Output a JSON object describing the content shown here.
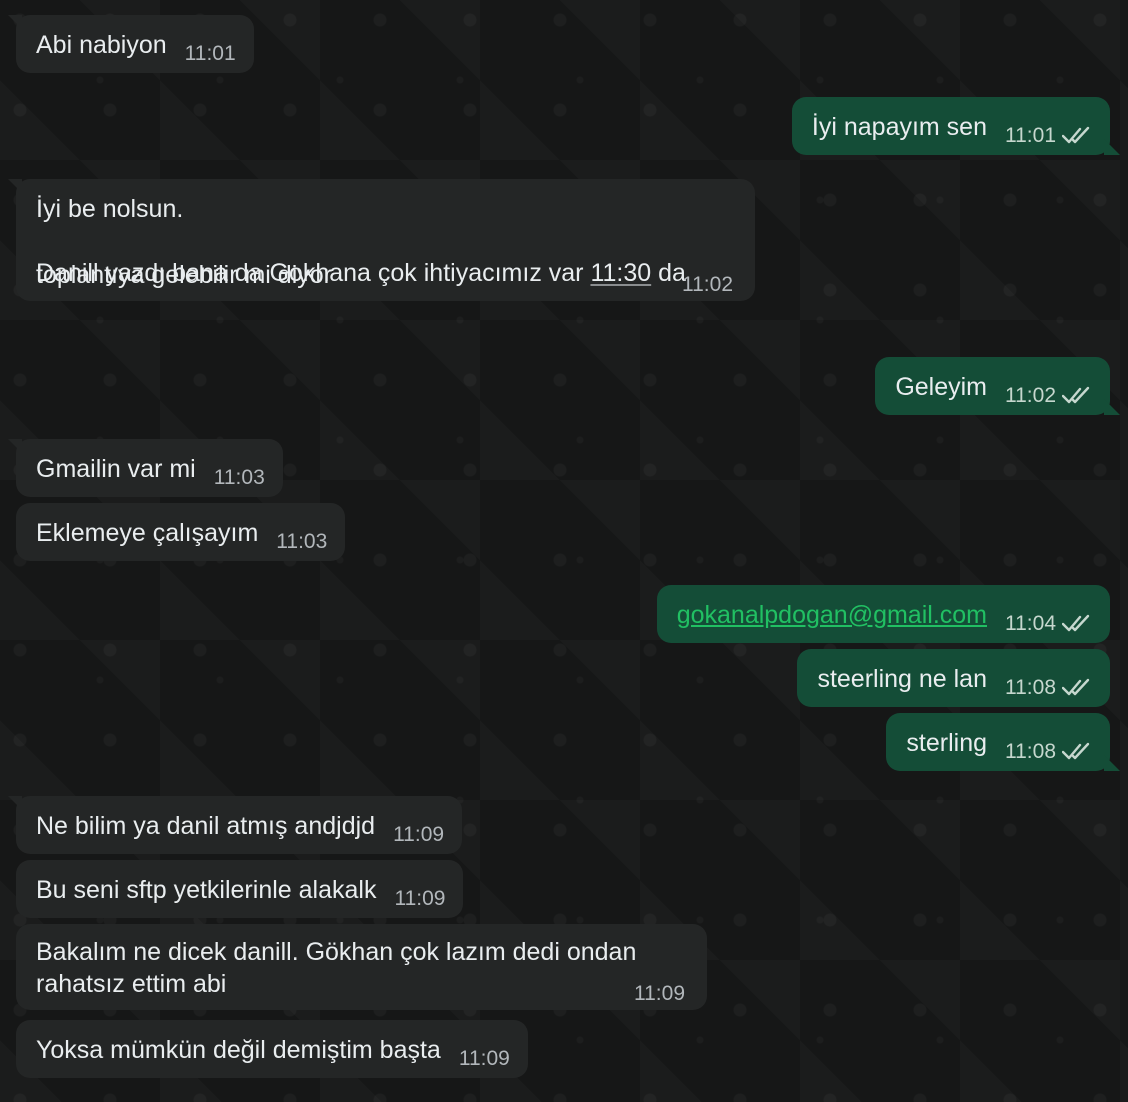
{
  "messages": [
    {
      "id": "m1",
      "direction": "incoming",
      "text": "Abi nabiyon",
      "time": "11:01"
    },
    {
      "id": "m2",
      "direction": "outgoing",
      "text": "İyi napayım sen",
      "time": "11:01",
      "status": "read"
    },
    {
      "id": "m3",
      "direction": "incoming",
      "line1": "İyi be nolsun.",
      "line2_pre": "Danill yazdı bana da Gokhana çok ihtiyacımız var ",
      "line2_link": "11:30",
      "line2_post": " da",
      "line3": "toplantıya gelebilir mi diyor",
      "time": "11:02"
    },
    {
      "id": "m4",
      "direction": "outgoing",
      "text": "Geleyim",
      "time": "11:02",
      "status": "read"
    },
    {
      "id": "m5",
      "direction": "incoming",
      "text": "Gmailin var mi",
      "time": "11:03"
    },
    {
      "id": "m6",
      "direction": "incoming",
      "text": "Eklemeye çalışayım",
      "time": "11:03"
    },
    {
      "id": "m7",
      "direction": "outgoing",
      "text": "gokanalpdogan@gmail.com",
      "time": "11:04",
      "status": "read"
    },
    {
      "id": "m8",
      "direction": "outgoing",
      "text": "steerling ne lan",
      "time": "11:08",
      "status": "read"
    },
    {
      "id": "m9",
      "direction": "outgoing",
      "text": "sterling",
      "time": "11:08",
      "status": "read"
    },
    {
      "id": "m10",
      "direction": "incoming",
      "text": "Ne bilim ya danil atmış andjdjd",
      "time": "11:09"
    },
    {
      "id": "m11",
      "direction": "incoming",
      "text": "Bu seni sftp yetkilerinle alakalk",
      "time": "11:09"
    },
    {
      "id": "m12",
      "direction": "incoming",
      "line1": "Bakalım ne dicek danill. Gökhan çok lazım dedi ondan",
      "line2": "rahatsız ettim abi",
      "time": "11:09"
    },
    {
      "id": "m13",
      "direction": "incoming",
      "text": "Yoksa mümkün değil demiştim başta",
      "time": "11:09"
    }
  ],
  "icons": {
    "read_receipt": "double-check-icon"
  },
  "colors": {
    "background": "#161717",
    "incoming_bubble": "#242626",
    "outgoing_bubble": "#144d37",
    "link": "#21c063"
  }
}
